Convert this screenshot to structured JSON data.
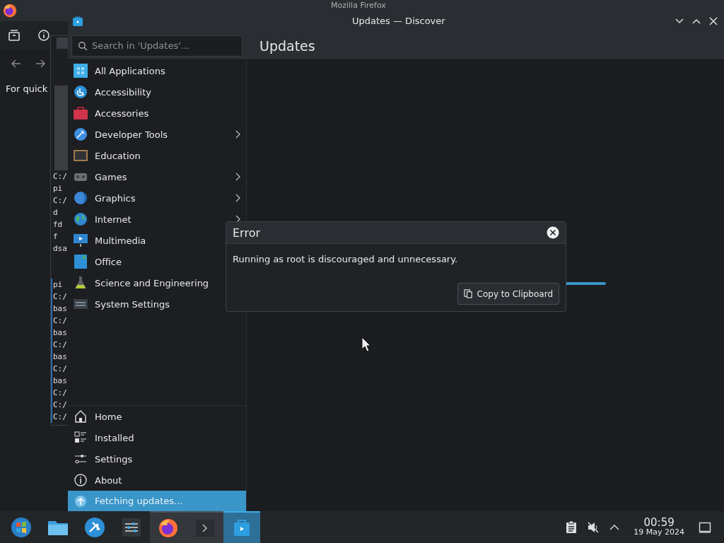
{
  "firefox_window": {
    "title": "Mozilla Firefox",
    "page_text": "For quick"
  },
  "terminal_window": {
    "blocks": [
      {
        "highlighted": false,
        "lines": [
          "C:/",
          "pi",
          "C:/",
          "d",
          "fd",
          "f",
          "dsa"
        ]
      },
      {
        "highlighted": true,
        "lines": [
          "pi",
          "C:/",
          "bas",
          "C:/",
          "bas",
          "C:/",
          "bas",
          "C:/",
          "bas",
          "C:/",
          "C:/",
          "C:/"
        ]
      }
    ]
  },
  "discover_window": {
    "title": "Updates — Discover",
    "search": {
      "placeholder": "Search in 'Updates'..."
    },
    "page_title": "Updates",
    "categories": [
      {
        "label": "All Applications",
        "kind": "grid",
        "has_submenu": false
      },
      {
        "label": "Accessibility",
        "kind": "accessibility",
        "has_submenu": false
      },
      {
        "label": "Accessories",
        "kind": "toolbox",
        "has_submenu": false
      },
      {
        "label": "Developer Tools",
        "kind": "developer",
        "has_submenu": true
      },
      {
        "label": "Education",
        "kind": "board",
        "has_submenu": false
      },
      {
        "label": "Games",
        "kind": "gamepad",
        "has_submenu": true
      },
      {
        "label": "Graphics",
        "kind": "graphics",
        "has_submenu": true
      },
      {
        "label": "Internet",
        "kind": "globe",
        "has_submenu": true
      },
      {
        "label": "Multimedia",
        "kind": "media",
        "has_submenu": false
      },
      {
        "label": "Office",
        "kind": "office",
        "has_submenu": false
      },
      {
        "label": "Science and Engineering",
        "kind": "flask",
        "has_submenu": false
      },
      {
        "label": "System Settings",
        "kind": "system",
        "has_submenu": false
      }
    ],
    "nav": [
      {
        "label": "Home",
        "kind": "home"
      },
      {
        "label": "Installed",
        "kind": "installed"
      },
      {
        "label": "Settings",
        "kind": "settings"
      },
      {
        "label": "About",
        "kind": "about"
      }
    ],
    "status": {
      "text": "Fetching updates..."
    }
  },
  "dialog": {
    "title": "Error",
    "message": "Running as root is discouraged and unnecessary.",
    "button": "Copy to Clipboard"
  },
  "taskbar": {
    "apps": [
      {
        "kind": "start",
        "running": false,
        "focused": false
      },
      {
        "kind": "folder",
        "running": false,
        "focused": false
      },
      {
        "kind": "kite",
        "running": false,
        "focused": false
      },
      {
        "kind": "sliders",
        "running": false,
        "focused": false
      },
      {
        "kind": "firefox",
        "running": true,
        "focused": false
      },
      {
        "kind": "terminal",
        "running": true,
        "focused": false
      },
      {
        "kind": "discover",
        "running": true,
        "focused": true
      }
    ],
    "clock": {
      "time": "00:59",
      "date": "19 May 2024"
    }
  }
}
